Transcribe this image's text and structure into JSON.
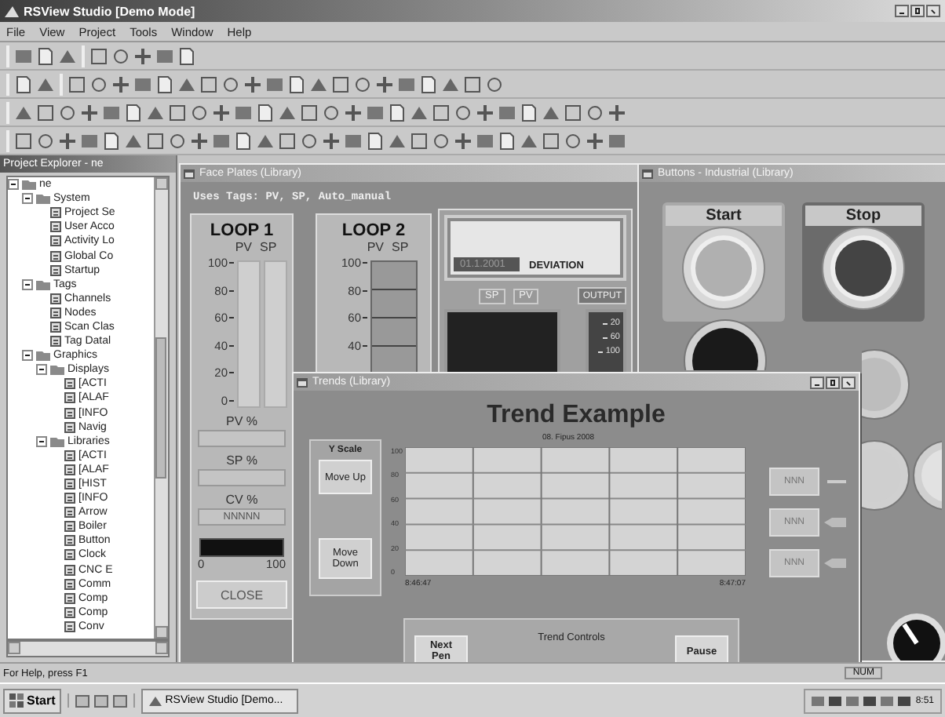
{
  "window": {
    "title": "RSView Studio  [Demo Mode]"
  },
  "menu": [
    "File",
    "View",
    "Project",
    "Tools",
    "Window",
    "Help"
  ],
  "project_explorer": {
    "title": "Project Explorer - ne",
    "tree": [
      {
        "label": "ne",
        "expanded": true,
        "children": [
          {
            "label": "System",
            "expanded": true,
            "children": [
              {
                "label": "Project Se"
              },
              {
                "label": "User Acco"
              },
              {
                "label": "Activity Lo"
              },
              {
                "label": "Global Co"
              },
              {
                "label": "Startup"
              }
            ]
          },
          {
            "label": "Tags",
            "expanded": true,
            "children": [
              {
                "label": "Channels"
              },
              {
                "label": "Nodes"
              },
              {
                "label": "Scan Clas"
              },
              {
                "label": "Tag Datal"
              }
            ]
          },
          {
            "label": "Graphics",
            "expanded": true,
            "children": [
              {
                "label": "Displays",
                "expanded": true,
                "children": [
                  {
                    "label": "[ACTI"
                  },
                  {
                    "label": "[ALAF"
                  },
                  {
                    "label": "[INFO"
                  },
                  {
                    "label": "Navig"
                  }
                ]
              },
              {
                "label": "Libraries",
                "expanded": true,
                "children": [
                  {
                    "label": "[ACTI"
                  },
                  {
                    "label": "[ALAF"
                  },
                  {
                    "label": "[HIST"
                  },
                  {
                    "label": "[INFO"
                  },
                  {
                    "label": "Arrow"
                  },
                  {
                    "label": "Boiler"
                  },
                  {
                    "label": "Button"
                  },
                  {
                    "label": "Clock"
                  },
                  {
                    "label": "CNC E"
                  },
                  {
                    "label": "Comm"
                  },
                  {
                    "label": "Comp"
                  },
                  {
                    "label": "Comp"
                  },
                  {
                    "label": "Conv"
                  }
                ]
              }
            ]
          }
        ]
      }
    ]
  },
  "face_plates": {
    "title": "Face Plates (Library)",
    "tags_line": "Uses Tags: PV, SP, Auto_manual",
    "loop_1": {
      "title": "LOOP 1",
      "pv": "PV",
      "sp": "SP",
      "scale": [
        "100",
        "80",
        "60",
        "40",
        "20",
        "0"
      ],
      "pv_pct": "PV %",
      "sp_pct": "SP %",
      "cv_pct": "CV %",
      "cv_value": "NNNNN",
      "bar_min": "0",
      "bar_max": "100",
      "close": "CLOSE"
    },
    "loop_2": {
      "title": "LOOP 2",
      "pv": "PV",
      "sp": "SP",
      "scale": [
        "100",
        "80",
        "60",
        "40"
      ]
    },
    "deviation": {
      "date": "01.1.2001",
      "label": "DEVIATION",
      "sp": "SP",
      "pv": "PV",
      "output": "OUTPUT",
      "readings": [
        "20",
        "60",
        "100"
      ]
    }
  },
  "buttons_window": {
    "title": "Buttons - Industrial (Library)",
    "start": "Start",
    "stop": "Stop"
  },
  "trends": {
    "title": "Trends (Library)",
    "heading": "Trend Example",
    "date": "08. Fipus 2008",
    "y_scale": "Y Scale",
    "move_up": "Move Up",
    "move_down": "Move Down",
    "y_labels": [
      "100",
      "80",
      "60",
      "40",
      "20",
      "0"
    ],
    "x_start": "8:46:47",
    "x_end": "8:47:07",
    "pens": [
      "NNN",
      "NNN",
      "NNN"
    ],
    "controls_title": "Trend Controls",
    "next_pen": "Next Pen",
    "pause": "Pause"
  },
  "status_bar": {
    "help": "For Help, press F1",
    "num": "NUM"
  },
  "taskbar": {
    "start": "Start",
    "task": "RSView Studio  [Demo...",
    "clock": "8:51"
  }
}
